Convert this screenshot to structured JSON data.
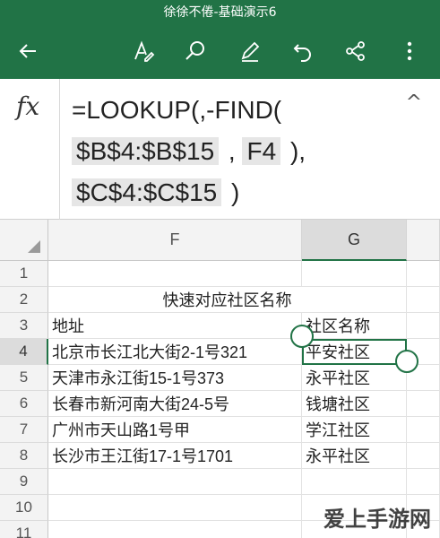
{
  "window": {
    "title": "徐徐不倦-基础演示6"
  },
  "toolbar": {
    "icons": [
      "back-arrow-icon",
      "format-text-icon",
      "search-icon",
      "pen-icon",
      "undo-icon",
      "share-icon",
      "more-vertical-icon"
    ]
  },
  "formula_bar": {
    "fx_label": "fx",
    "line1": "=LOOKUP(,-FIND(",
    "ref1": "$B$4:$B$15",
    "sep1": " , ",
    "ref2": "F4",
    "tail1": " ),",
    "ref3": "$C$4:$C$15",
    "tail2": " )",
    "collapse_glyph": "^"
  },
  "grid": {
    "columns": [
      "F",
      "G"
    ],
    "rows": [
      "1",
      "2",
      "3",
      "4",
      "5",
      "6",
      "7",
      "8",
      "9",
      "10",
      "11"
    ],
    "selected_cell": "G4",
    "cells": {
      "title": "快速对应社区名称",
      "header_address": "地址",
      "header_community": "社区名称",
      "r4_address": "北京市长江北大街2-1号321",
      "r4_community": "平安社区",
      "r5_address": "天津市永江街15-1号373",
      "r5_community": "永平社区",
      "r6_address": "长春市新河南大街24-5号",
      "r6_community": "钱塘社区",
      "r7_address": "广州市天山路1号甲",
      "r7_community": "学江社区",
      "r8_address": "长沙市王江街17-1号1701",
      "r8_community": "永平社区"
    }
  },
  "watermark": "爱上手游网",
  "colors": {
    "accent": "#217346",
    "header_bg": "#f3f3f3",
    "ref_bg": "#e6e6e6"
  }
}
